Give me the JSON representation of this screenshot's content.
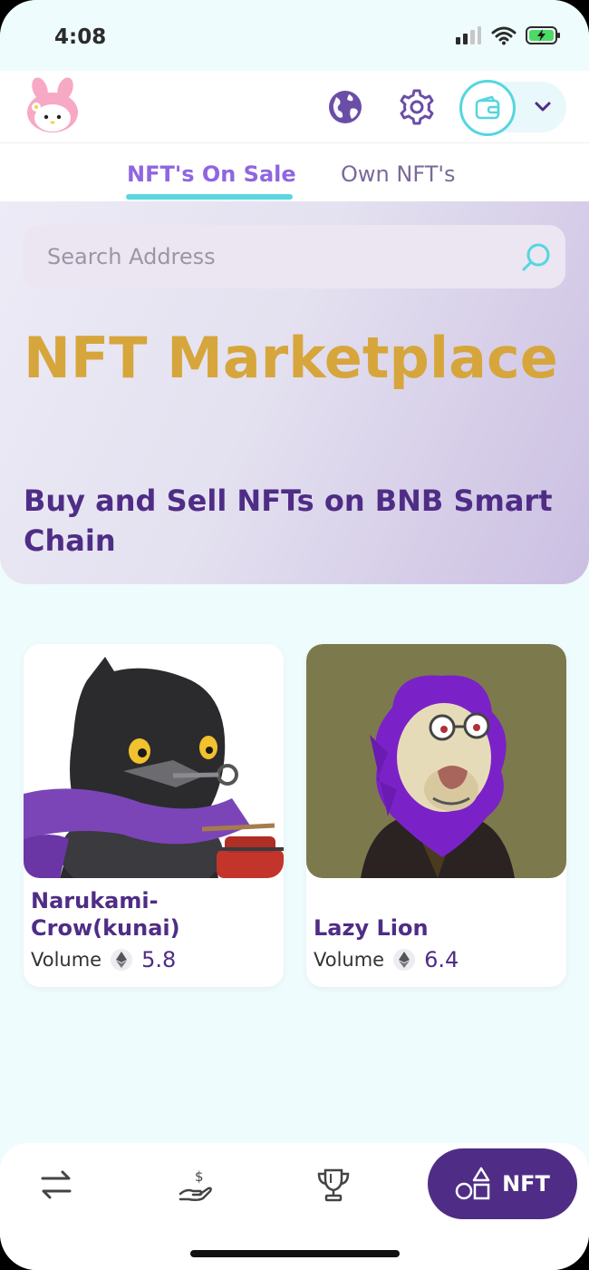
{
  "status_bar": {
    "time": "4:08"
  },
  "header": {
    "logo_icon": "bunny-logo-icon",
    "globe_icon": "globe-icon",
    "settings_icon": "gear-icon",
    "wallet_icon": "wallet-icon",
    "dropdown_icon": "chevron-down-icon"
  },
  "tabs": [
    {
      "label": "NFT's On Sale",
      "active": true
    },
    {
      "label": "Own NFT's",
      "active": false
    }
  ],
  "search": {
    "placeholder": "Search Address",
    "value": ""
  },
  "hero": {
    "title": "NFT Marketplace",
    "subtitle": "Buy and Sell NFTs on BNB Smart Chain"
  },
  "nfts": [
    {
      "name": "Narukami-Crow(kunai)",
      "volume_label": "Volume",
      "volume": "5.8"
    },
    {
      "name": "Lazy Lion",
      "volume_label": "Volume",
      "volume": "6.4"
    }
  ],
  "bottom_nav": {
    "items": [
      "swap-icon",
      "earn-icon",
      "trophy-icon"
    ],
    "nft_label": "NFT"
  },
  "colors": {
    "accent_purple": "#4f2d86",
    "tab_active": "#8f66e0",
    "accent_cyan": "#54d6df",
    "title_gold": "#d6a63c",
    "background": "#eefcfd"
  }
}
